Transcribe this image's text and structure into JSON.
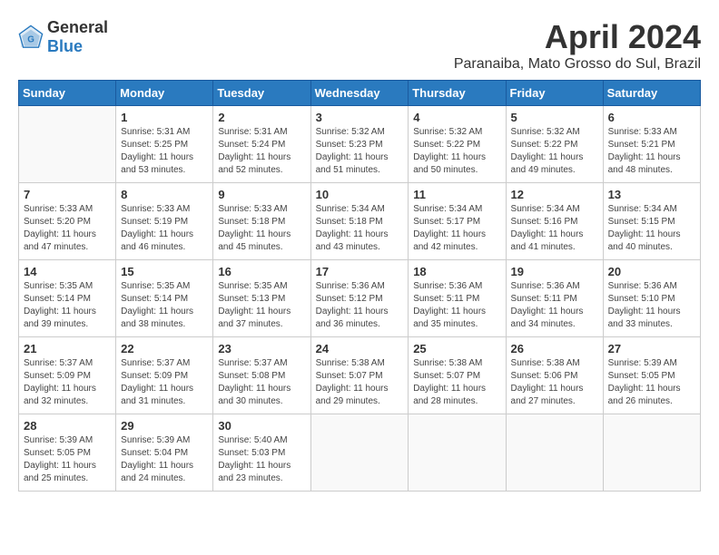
{
  "logo": {
    "general": "General",
    "blue": "Blue"
  },
  "title": {
    "month_year": "April 2024",
    "location": "Paranaiba, Mato Grosso do Sul, Brazil"
  },
  "weekdays": [
    "Sunday",
    "Monday",
    "Tuesday",
    "Wednesday",
    "Thursday",
    "Friday",
    "Saturday"
  ],
  "weeks": [
    [
      {
        "day": "",
        "sunrise": "",
        "sunset": "",
        "daylight": ""
      },
      {
        "day": "1",
        "sunrise": "Sunrise: 5:31 AM",
        "sunset": "Sunset: 5:25 PM",
        "daylight": "Daylight: 11 hours and 53 minutes."
      },
      {
        "day": "2",
        "sunrise": "Sunrise: 5:31 AM",
        "sunset": "Sunset: 5:24 PM",
        "daylight": "Daylight: 11 hours and 52 minutes."
      },
      {
        "day": "3",
        "sunrise": "Sunrise: 5:32 AM",
        "sunset": "Sunset: 5:23 PM",
        "daylight": "Daylight: 11 hours and 51 minutes."
      },
      {
        "day": "4",
        "sunrise": "Sunrise: 5:32 AM",
        "sunset": "Sunset: 5:22 PM",
        "daylight": "Daylight: 11 hours and 50 minutes."
      },
      {
        "day": "5",
        "sunrise": "Sunrise: 5:32 AM",
        "sunset": "Sunset: 5:22 PM",
        "daylight": "Daylight: 11 hours and 49 minutes."
      },
      {
        "day": "6",
        "sunrise": "Sunrise: 5:33 AM",
        "sunset": "Sunset: 5:21 PM",
        "daylight": "Daylight: 11 hours and 48 minutes."
      }
    ],
    [
      {
        "day": "7",
        "sunrise": "Sunrise: 5:33 AM",
        "sunset": "Sunset: 5:20 PM",
        "daylight": "Daylight: 11 hours and 47 minutes."
      },
      {
        "day": "8",
        "sunrise": "Sunrise: 5:33 AM",
        "sunset": "Sunset: 5:19 PM",
        "daylight": "Daylight: 11 hours and 46 minutes."
      },
      {
        "day": "9",
        "sunrise": "Sunrise: 5:33 AM",
        "sunset": "Sunset: 5:18 PM",
        "daylight": "Daylight: 11 hours and 45 minutes."
      },
      {
        "day": "10",
        "sunrise": "Sunrise: 5:34 AM",
        "sunset": "Sunset: 5:18 PM",
        "daylight": "Daylight: 11 hours and 43 minutes."
      },
      {
        "day": "11",
        "sunrise": "Sunrise: 5:34 AM",
        "sunset": "Sunset: 5:17 PM",
        "daylight": "Daylight: 11 hours and 42 minutes."
      },
      {
        "day": "12",
        "sunrise": "Sunrise: 5:34 AM",
        "sunset": "Sunset: 5:16 PM",
        "daylight": "Daylight: 11 hours and 41 minutes."
      },
      {
        "day": "13",
        "sunrise": "Sunrise: 5:34 AM",
        "sunset": "Sunset: 5:15 PM",
        "daylight": "Daylight: 11 hours and 40 minutes."
      }
    ],
    [
      {
        "day": "14",
        "sunrise": "Sunrise: 5:35 AM",
        "sunset": "Sunset: 5:14 PM",
        "daylight": "Daylight: 11 hours and 39 minutes."
      },
      {
        "day": "15",
        "sunrise": "Sunrise: 5:35 AM",
        "sunset": "Sunset: 5:14 PM",
        "daylight": "Daylight: 11 hours and 38 minutes."
      },
      {
        "day": "16",
        "sunrise": "Sunrise: 5:35 AM",
        "sunset": "Sunset: 5:13 PM",
        "daylight": "Daylight: 11 hours and 37 minutes."
      },
      {
        "day": "17",
        "sunrise": "Sunrise: 5:36 AM",
        "sunset": "Sunset: 5:12 PM",
        "daylight": "Daylight: 11 hours and 36 minutes."
      },
      {
        "day": "18",
        "sunrise": "Sunrise: 5:36 AM",
        "sunset": "Sunset: 5:11 PM",
        "daylight": "Daylight: 11 hours and 35 minutes."
      },
      {
        "day": "19",
        "sunrise": "Sunrise: 5:36 AM",
        "sunset": "Sunset: 5:11 PM",
        "daylight": "Daylight: 11 hours and 34 minutes."
      },
      {
        "day": "20",
        "sunrise": "Sunrise: 5:36 AM",
        "sunset": "Sunset: 5:10 PM",
        "daylight": "Daylight: 11 hours and 33 minutes."
      }
    ],
    [
      {
        "day": "21",
        "sunrise": "Sunrise: 5:37 AM",
        "sunset": "Sunset: 5:09 PM",
        "daylight": "Daylight: 11 hours and 32 minutes."
      },
      {
        "day": "22",
        "sunrise": "Sunrise: 5:37 AM",
        "sunset": "Sunset: 5:09 PM",
        "daylight": "Daylight: 11 hours and 31 minutes."
      },
      {
        "day": "23",
        "sunrise": "Sunrise: 5:37 AM",
        "sunset": "Sunset: 5:08 PM",
        "daylight": "Daylight: 11 hours and 30 minutes."
      },
      {
        "day": "24",
        "sunrise": "Sunrise: 5:38 AM",
        "sunset": "Sunset: 5:07 PM",
        "daylight": "Daylight: 11 hours and 29 minutes."
      },
      {
        "day": "25",
        "sunrise": "Sunrise: 5:38 AM",
        "sunset": "Sunset: 5:07 PM",
        "daylight": "Daylight: 11 hours and 28 minutes."
      },
      {
        "day": "26",
        "sunrise": "Sunrise: 5:38 AM",
        "sunset": "Sunset: 5:06 PM",
        "daylight": "Daylight: 11 hours and 27 minutes."
      },
      {
        "day": "27",
        "sunrise": "Sunrise: 5:39 AM",
        "sunset": "Sunset: 5:05 PM",
        "daylight": "Daylight: 11 hours and 26 minutes."
      }
    ],
    [
      {
        "day": "28",
        "sunrise": "Sunrise: 5:39 AM",
        "sunset": "Sunset: 5:05 PM",
        "daylight": "Daylight: 11 hours and 25 minutes."
      },
      {
        "day": "29",
        "sunrise": "Sunrise: 5:39 AM",
        "sunset": "Sunset: 5:04 PM",
        "daylight": "Daylight: 11 hours and 24 minutes."
      },
      {
        "day": "30",
        "sunrise": "Sunrise: 5:40 AM",
        "sunset": "Sunset: 5:03 PM",
        "daylight": "Daylight: 11 hours and 23 minutes."
      },
      {
        "day": "",
        "sunrise": "",
        "sunset": "",
        "daylight": ""
      },
      {
        "day": "",
        "sunrise": "",
        "sunset": "",
        "daylight": ""
      },
      {
        "day": "",
        "sunrise": "",
        "sunset": "",
        "daylight": ""
      },
      {
        "day": "",
        "sunrise": "",
        "sunset": "",
        "daylight": ""
      }
    ]
  ]
}
